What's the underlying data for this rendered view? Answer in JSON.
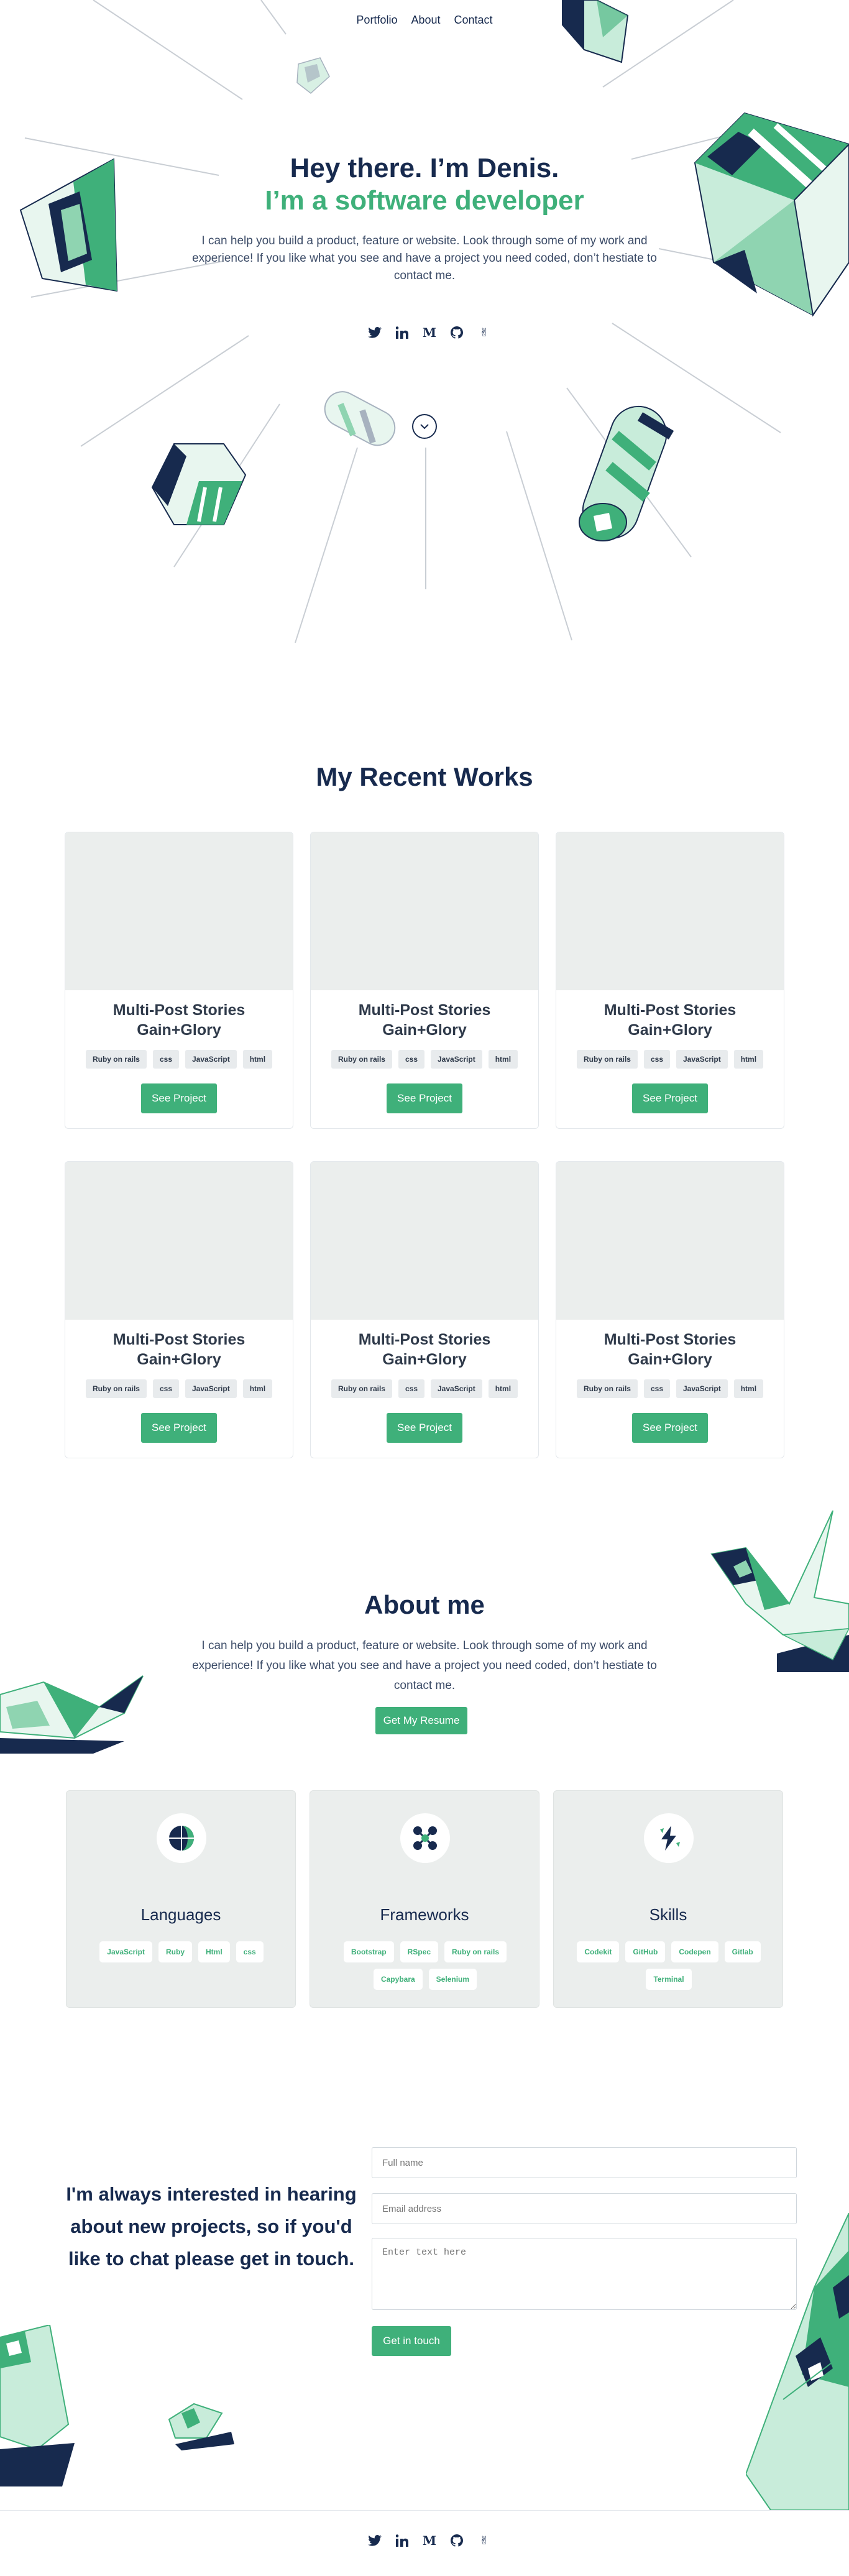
{
  "nav": {
    "items": [
      "Portfolio",
      "About",
      "Contact"
    ]
  },
  "hero": {
    "title": "Hey there. I’m Denis.",
    "subtitle": "I’m a software developer",
    "text": "I can help you build a product, feature or website. Look through some of my work and experience! If you like what you see and have a project you need coded, don’t hestiate to contact me."
  },
  "social": {
    "icons": [
      "twitter-icon",
      "linkedin-icon",
      "medium-icon",
      "github-icon",
      "angellist-icon"
    ]
  },
  "works": {
    "title": "My Recent Works",
    "projects": [
      {
        "title": "Multi-Post Stories Gain+Glory",
        "tags": [
          "Ruby on rails",
          "css",
          "JavaScript",
          "html"
        ],
        "button": "See Project"
      },
      {
        "title": "Multi-Post Stories Gain+Glory",
        "tags": [
          "Ruby on rails",
          "css",
          "JavaScript",
          "html"
        ],
        "button": "See Project"
      },
      {
        "title": "Multi-Post Stories Gain+Glory",
        "tags": [
          "Ruby on rails",
          "css",
          "JavaScript",
          "html"
        ],
        "button": "See Project"
      },
      {
        "title": "Multi-Post Stories Gain+Glory",
        "tags": [
          "Ruby on rails",
          "css",
          "JavaScript",
          "html"
        ],
        "button": "See Project"
      },
      {
        "title": "Multi-Post Stories Gain+Glory",
        "tags": [
          "Ruby on rails",
          "css",
          "JavaScript",
          "html"
        ],
        "button": "See Project"
      },
      {
        "title": "Multi-Post Stories Gain+Glory",
        "tags": [
          "Ruby on rails",
          "css",
          "JavaScript",
          "html"
        ],
        "button": "See Project"
      }
    ]
  },
  "about": {
    "title": "About me",
    "text": "I can help you build a product, feature or website. Look through some of my work and experience! If you like what you see and have a project you need coded, don’t hestiate to contact me.",
    "resume_button": "Get My Resume",
    "cards": [
      {
        "title": "Languages",
        "icon": "globe-icon",
        "chips": [
          "JavaScript",
          "Ruby",
          "Html",
          "css"
        ]
      },
      {
        "title": "Frameworks",
        "icon": "molecule-icon",
        "chips": [
          "Bootstrap",
          "RSpec",
          "Ruby on rails",
          "Capybara",
          "Selenium"
        ]
      },
      {
        "title": "Skills",
        "icon": "lightning-icon",
        "chips": [
          "Codekit",
          "GitHub",
          "Codepen",
          "Gitlab",
          "Terminal"
        ]
      }
    ]
  },
  "contact": {
    "text": "I'm always interested in hearing about new projects, so if you'd like to chat please get in touch.",
    "name_placeholder": "Full name",
    "email_placeholder": "Email address",
    "message_placeholder": "Enter text here",
    "submit": "Get in touch"
  },
  "colors": {
    "navy": "#172a4e",
    "green": "#3fb07a",
    "mint": "#c8ecda",
    "card_bg": "#ebeeed"
  }
}
